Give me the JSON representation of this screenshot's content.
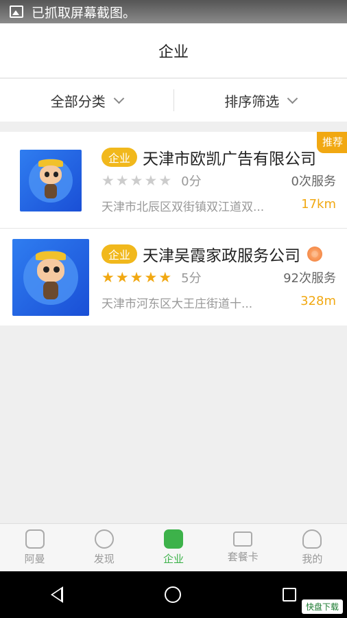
{
  "status_bar": {
    "text": "已抓取屏幕截图。"
  },
  "header": {
    "title": "企业"
  },
  "filters": {
    "category": "全部分类",
    "sort": "排序筛选"
  },
  "companies": [
    {
      "tag": "企业",
      "name": "天津市欧凯广告有限公司",
      "rating": "0分",
      "stars_filled": 0,
      "services": "0次服务",
      "address": "天津市北辰区双街镇双江道双...",
      "distance": "17km",
      "badge": "推荐"
    },
    {
      "tag": "企业",
      "name": "天津吴霞家政服务公司",
      "rating": "5分",
      "stars_filled": 5,
      "services": "92次服务",
      "address": "天津市河东区大王庄街道十...",
      "distance": "328m",
      "badge": ""
    }
  ],
  "tabs": [
    {
      "label": "阿曼",
      "icon": "home-icon"
    },
    {
      "label": "发现",
      "icon": "compass-icon"
    },
    {
      "label": "企业",
      "icon": "building-icon",
      "active": true
    },
    {
      "label": "套餐卡",
      "icon": "card-icon"
    },
    {
      "label": "我的",
      "icon": "user-icon"
    }
  ],
  "watermark": "快盘下载",
  "colors": {
    "accent": "#3db24a",
    "tag": "#f1b81c",
    "distance": "#f1a812",
    "star": "#f1a812"
  }
}
